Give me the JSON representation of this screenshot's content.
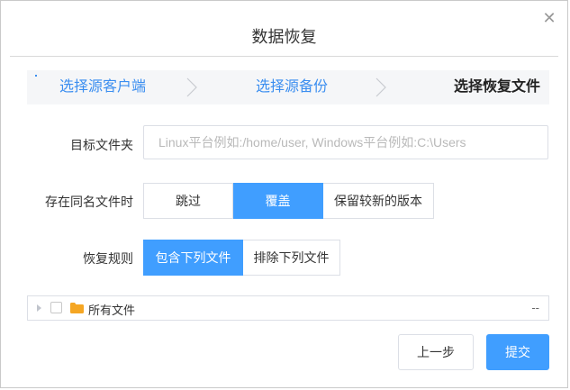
{
  "dialog": {
    "title": "数据恢复",
    "close_icon": "close-icon"
  },
  "steps": [
    {
      "label": "选择源客户端",
      "state": "done"
    },
    {
      "label": "选择源备份",
      "state": "done"
    },
    {
      "label": "选择恢复文件",
      "state": "current"
    }
  ],
  "form": {
    "target_folder": {
      "label": "目标文件夹",
      "value": "",
      "placeholder": "Linux平台例如:/home/user, Windows平台例如:C:\\Users"
    },
    "same_name": {
      "label": "存在同名文件时",
      "options": [
        "跳过",
        "覆盖",
        "保留较新的版本"
      ],
      "selected": "覆盖"
    },
    "restore_rule": {
      "label": "恢复规则",
      "options": [
        "包含下列文件",
        "排除下列文件"
      ],
      "selected": "包含下列文件"
    }
  },
  "tree": {
    "root": {
      "label": "所有文件",
      "checked": false,
      "expanded": false,
      "trailing": "--"
    }
  },
  "buttons": {
    "prev": "上一步",
    "submit": "提交"
  },
  "colors": {
    "primary": "#409eff",
    "step_active": "#3b8ef0",
    "folder": "#f5a623"
  }
}
